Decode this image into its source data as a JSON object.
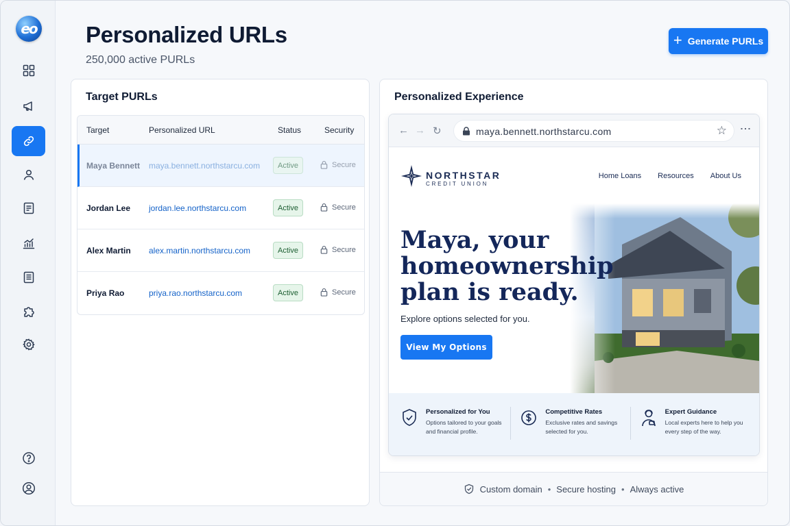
{
  "app": {
    "logo_text": "eo"
  },
  "sidebar": {
    "items": [
      {
        "name": "dashboard",
        "icon": "grid-icon"
      },
      {
        "name": "campaigns",
        "icon": "megaphone-icon"
      },
      {
        "name": "purls",
        "icon": "link-icon",
        "active": true
      },
      {
        "name": "contacts",
        "icon": "user-icon"
      },
      {
        "name": "forms",
        "icon": "document-icon"
      },
      {
        "name": "analytics",
        "icon": "chart-icon"
      },
      {
        "name": "reports",
        "icon": "list-icon"
      },
      {
        "name": "integrations",
        "icon": "puzzle-icon"
      },
      {
        "name": "settings",
        "icon": "gear-icon"
      }
    ],
    "bottom": [
      {
        "name": "help",
        "icon": "help-icon"
      },
      {
        "name": "profile",
        "icon": "profile-icon"
      }
    ]
  },
  "header": {
    "title": "Personalized URLs",
    "subtitle": "250,000 active PURLs",
    "generate_button": "Generate PURLs"
  },
  "targets": {
    "title": "Target PURLs",
    "columns": [
      "Target",
      "Personalized URL",
      "Status",
      "Security"
    ],
    "rows": [
      {
        "name": "Maya Bennett",
        "url": "maya.bennett.northstarcu.com",
        "status": "Active",
        "security": "Secure",
        "selected": true
      },
      {
        "name": "Jordan Lee",
        "url": "jordan.lee.northstarcu.com",
        "status": "Active",
        "security": "Secure"
      },
      {
        "name": "Alex Martin",
        "url": "alex.martin.northstarcu.com",
        "status": "Active",
        "security": "Secure"
      },
      {
        "name": "Priya Rao",
        "url": "priya.rao.northstarcu.com",
        "status": "Active",
        "security": "Secure"
      }
    ]
  },
  "experience": {
    "title": "Personalized Experience",
    "browser": {
      "address": "maya.bennett.northstarcu.com"
    },
    "site": {
      "brand_name": "NORTHSTAR",
      "brand_sub": "CREDIT UNION",
      "nav": [
        "Home Loans",
        "Resources",
        "About Us"
      ],
      "headline": "Maya, your homeownership plan is ready.",
      "subhead": "Explore options selected for you.",
      "cta": "View My Options",
      "features": [
        {
          "icon": "shield-check-icon",
          "title": "Personalized for You",
          "desc": "Options tailored to your goals and financial profile."
        },
        {
          "icon": "dollar-circle-icon",
          "title": "Competitive Rates",
          "desc": "Exclusive rates and savings selected for you."
        },
        {
          "icon": "advisor-icon",
          "title": "Expert Guidance",
          "desc": "Local experts here to help you every step of the way."
        }
      ]
    },
    "footer": [
      "Custom domain",
      "Secure hosting",
      "Always active"
    ]
  },
  "colors": {
    "accent": "#1877f2",
    "navy": "#14275a",
    "success_bg": "#e6f5ea"
  }
}
